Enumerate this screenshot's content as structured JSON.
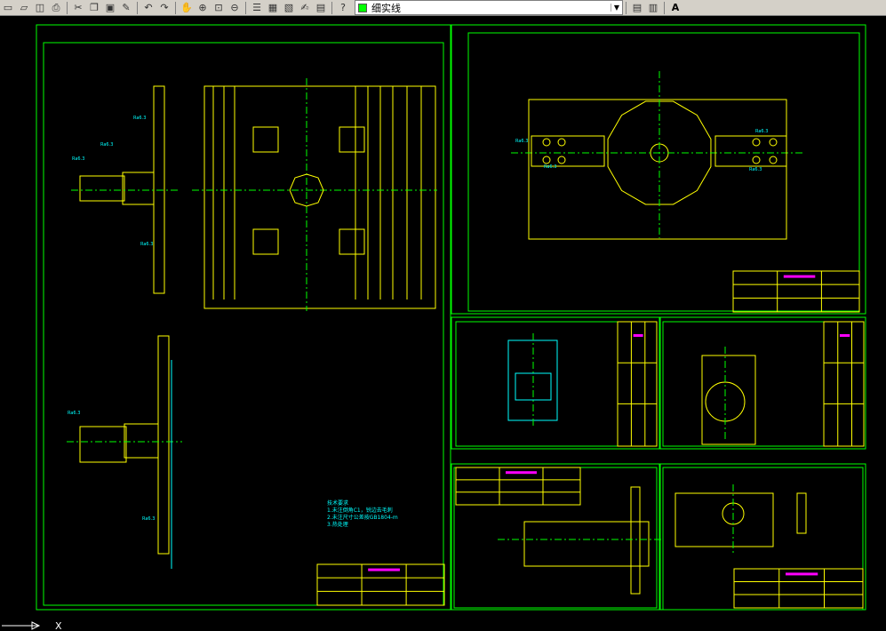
{
  "toolbar": {
    "icons": [
      "new-icon",
      "open-icon",
      "save-icon",
      "print-icon",
      "cut-icon",
      "copy-icon",
      "paste-icon",
      "match-properties-icon",
      "undo-icon",
      "redo-icon",
      "pan-icon",
      "zoom-realtime-icon",
      "zoom-window-icon",
      "zoom-previous-icon",
      "properties-icon",
      "design-center-icon",
      "tool-palettes-icon",
      "markup-icon",
      "calculator-icon",
      "help-icon"
    ],
    "linetype_label": "细实线",
    "text_style_glyph": "A"
  },
  "colors": {
    "frame": "#00ff00",
    "geometry": "#ffff00",
    "center": "#00ff00",
    "dim": "#00ffff",
    "tag": "#ff00ff",
    "bg": "#000000"
  },
  "drawing": {
    "notes": [
      "技术要求",
      "1.未注倒角C1，锐边去毛刺",
      "2.未注尺寸公差按GB1804-m",
      "3.热处理"
    ],
    "ucs_label": "X",
    "ra_label": "Ra6.3"
  }
}
